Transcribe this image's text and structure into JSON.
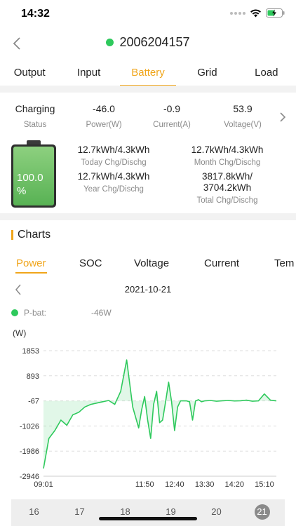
{
  "status_bar": {
    "time": "14:32"
  },
  "nav": {
    "title": "2006204157"
  },
  "main_tabs": [
    {
      "label": "Output"
    },
    {
      "label": "Input"
    },
    {
      "label": "Battery"
    },
    {
      "label": "Grid"
    },
    {
      "label": "Load"
    }
  ],
  "summary": {
    "status": {
      "value": "Charging",
      "label": "Status"
    },
    "power": {
      "value": "-46.0",
      "label": "Power(W)"
    },
    "current": {
      "value": "-0.9",
      "label": "Current(A)"
    },
    "voltage": {
      "value": "53.9",
      "label": "Voltage(V)"
    }
  },
  "battery": {
    "soc_text": "100.0",
    "soc_unit": "%",
    "soc_level": 1.0
  },
  "energy": {
    "today": {
      "value": "12.7kWh/4.3kWh",
      "label": "Today Chg/Dischg"
    },
    "month": {
      "value": "12.7kWh/4.3kWh",
      "label": "Month Chg/Dischg"
    },
    "year": {
      "value": "12.7kWh/4.3kWh",
      "label": "Year Chg/Dischg"
    },
    "total": {
      "value_line1": "3817.8kWh/",
      "value_line2": "3704.2kWh",
      "label": "Total Chg/Dischg"
    }
  },
  "charts": {
    "title": "Charts",
    "tabs": [
      {
        "label": "Power"
      },
      {
        "label": "SOC"
      },
      {
        "label": "Voltage"
      },
      {
        "label": "Current"
      },
      {
        "label": "Tem"
      }
    ],
    "date": "2021-10-21",
    "legend": {
      "name": "P-bat:",
      "value": "-46W"
    },
    "unit_label": "(W)"
  },
  "chart_data": {
    "type": "area",
    "ylabel": "(W)",
    "ylim": [
      -2946,
      1853
    ],
    "y_ticks": [
      "1853",
      "893",
      "-67",
      "-1026",
      "-1986",
      "-2946"
    ],
    "x_ticks": [
      "09:01",
      "11:50",
      "12:40",
      "13:30",
      "14:20",
      "15:10"
    ],
    "xlim": [
      "09:01",
      "15:30"
    ],
    "series": [
      {
        "name": "P-bat:",
        "color": "#2ec95c",
        "x": [
          "09:01",
          "09:10",
          "09:20",
          "09:30",
          "09:40",
          "09:50",
          "10:00",
          "10:10",
          "10:20",
          "10:30",
          "10:40",
          "10:50",
          "11:00",
          "11:10",
          "11:20",
          "11:30",
          "11:40",
          "11:45",
          "11:50",
          "11:55",
          "12:00",
          "12:05",
          "12:10",
          "12:15",
          "12:20",
          "12:25",
          "12:30",
          "12:35",
          "12:40",
          "12:45",
          "12:50",
          "12:55",
          "13:00",
          "13:05",
          "13:10",
          "13:15",
          "13:20",
          "13:25",
          "13:30",
          "13:40",
          "13:50",
          "14:00",
          "14:10",
          "14:20",
          "14:30",
          "14:40",
          "14:50",
          "15:00",
          "15:10",
          "15:20",
          "15:30"
        ],
        "values": [
          -2650,
          -1500,
          -1200,
          -800,
          -1000,
          -600,
          -500,
          -300,
          -200,
          -150,
          -100,
          -50,
          -200,
          300,
          1500,
          -300,
          -1100,
          -400,
          100,
          -800,
          -1500,
          -200,
          300,
          -900,
          -800,
          -100,
          650,
          -100,
          -1200,
          -300,
          -67,
          -67,
          -67,
          -100,
          -800,
          -67,
          -20,
          -100,
          -67,
          -50,
          -80,
          -60,
          -50,
          -70,
          -60,
          -40,
          -80,
          -67,
          200,
          -40,
          -67
        ]
      }
    ]
  },
  "day_strip": {
    "days": [
      "16",
      "17",
      "18",
      "19",
      "20",
      "21"
    ]
  }
}
